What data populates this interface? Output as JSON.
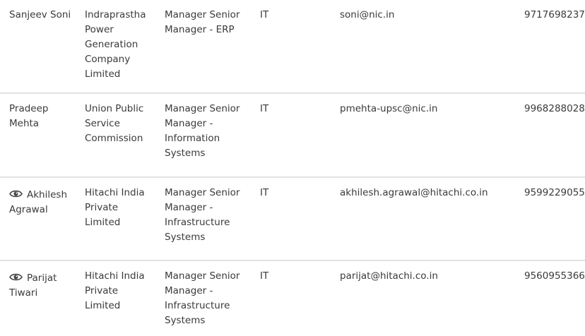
{
  "people": [
    {
      "name_line1": "Sanjeev Soni",
      "name_line2": "",
      "organization": "Indraprastha Power Generation Company Limited",
      "title": "Manager Senior Manager - ERP",
      "department": "IT",
      "email": "soni@nic.in",
      "phone": "9717698237"
    },
    {
      "name_line1": "Pradeep",
      "name_line2": "Mehta",
      "organization": "Union Public Service Commission",
      "title": "Manager Senior Manager - Information Systems",
      "department": "IT",
      "email": "pmehta-upsc@nic.in",
      "phone": "9968288028"
    },
    {
      "name_line1": "Akhilesh",
      "name_line2": "Agrawal",
      "organization": "Hitachi India Private Limited",
      "title": "Manager Senior Manager - Infrastructure Systems",
      "department": "IT",
      "email": "akhilesh.agrawal@hitachi.co.in",
      "phone": "9599229055",
      "icon": "eye-icon"
    },
    {
      "name_line1": "Parijat",
      "name_line2": "Tiwari",
      "organization": "Hitachi India Private Limited",
      "title": "Manager Senior Manager - Infrastructure Systems",
      "department": "IT",
      "email": "parijat@hitachi.co.in",
      "phone": "9560955366",
      "icon": "eye-icon"
    }
  ]
}
